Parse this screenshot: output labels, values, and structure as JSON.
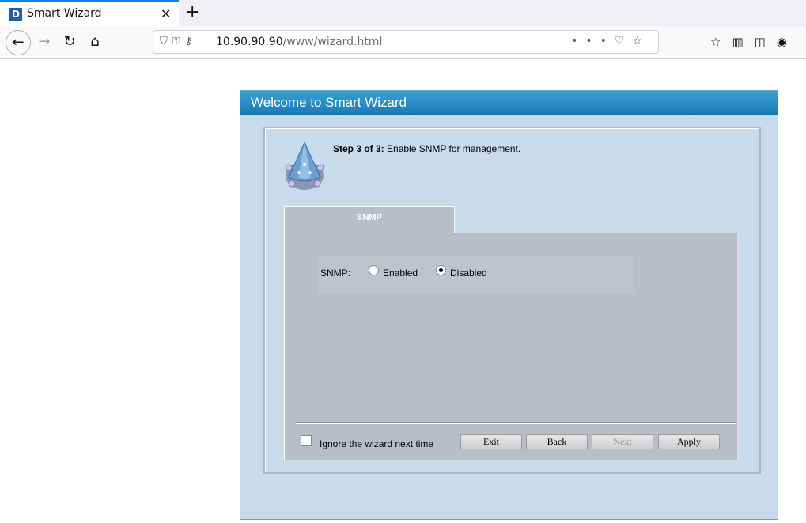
{
  "browser": {
    "tab_title": "Smart Wizard",
    "favicon_letter": "D",
    "close_glyph": "✕",
    "newtab_glyph": "+",
    "url_host": "10.90.90.90",
    "url_path": "/www/wizard.html"
  },
  "wizard": {
    "header_title": "Welcome to Smart Wizard",
    "step_label": "Step 3 of 3:",
    "step_description": " Enable SNMP for management.",
    "tab_label": "SNMP",
    "snmp_label": "SNMP:",
    "option_enabled": "Enabled",
    "option_disabled": "Disabled",
    "selected_option": "Disabled",
    "ignore_label": "Ignore the wizard next time",
    "ignore_checked": false,
    "buttons": {
      "exit": "Exit",
      "back": "Back",
      "next": "Next",
      "apply": "Apply"
    },
    "next_disabled": true
  },
  "colors": {
    "header_blue": "#1c7cb8",
    "wizard_bg": "#c8dbeb",
    "panel_gray": "#b8bdc6"
  }
}
